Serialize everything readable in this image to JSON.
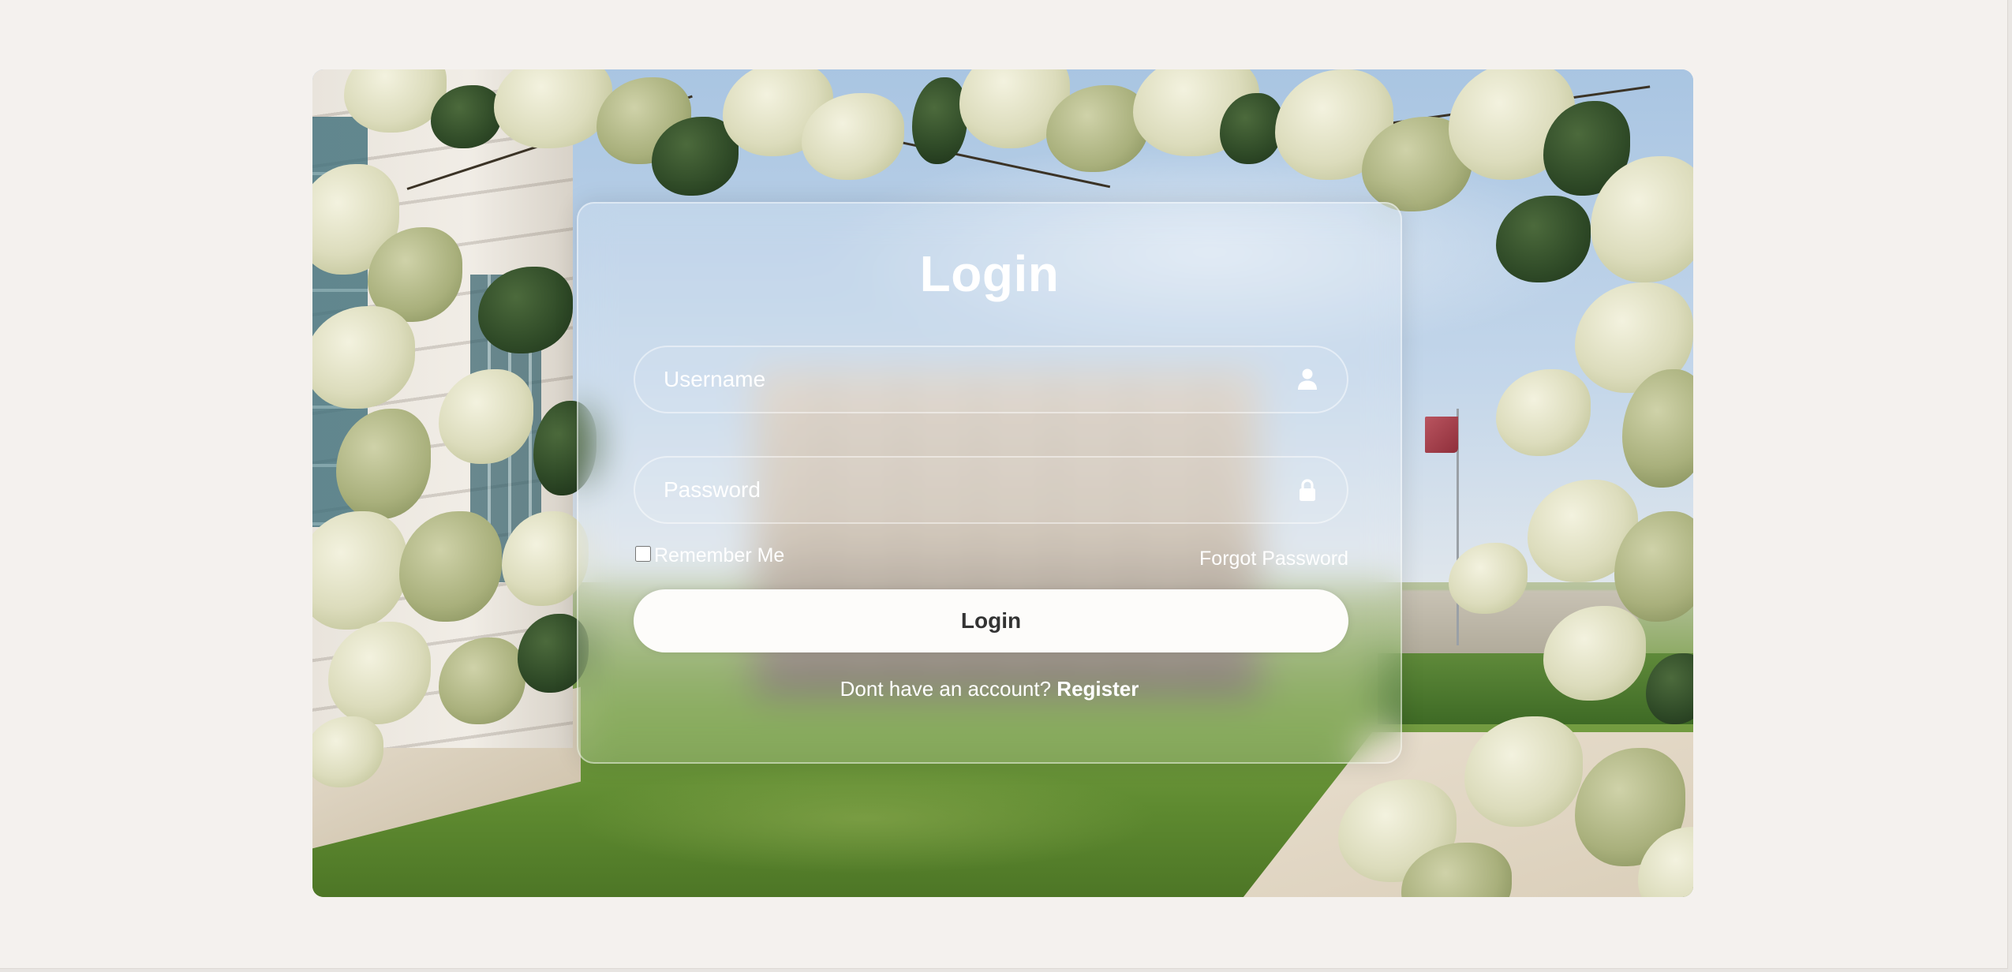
{
  "login_form": {
    "title": "Login",
    "username_placeholder": "Username",
    "username_value": "",
    "username_icon": "user-icon",
    "password_placeholder": "Password",
    "password_value": "",
    "password_icon": "lock-icon",
    "remember_me_label": "Remember Me",
    "remember_me_checked": false,
    "forgot_password_label": "Forgot Password",
    "submit_label": "Login",
    "register_prompt": "Dont have an account?",
    "register_link_label": "Register"
  },
  "colors": {
    "page_background": "#f4f1ee",
    "card_text": "#ffffff",
    "button_background": "#fdfcfa",
    "button_text": "#333333"
  }
}
